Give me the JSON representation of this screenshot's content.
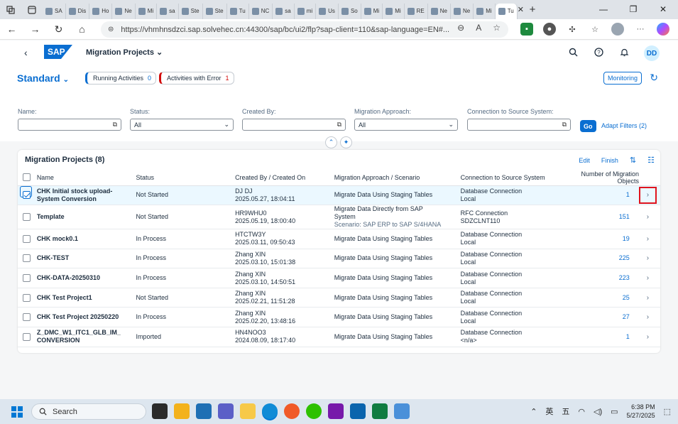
{
  "browser": {
    "tabs": [
      "SA",
      "Dis",
      "Ho",
      "Ne",
      "Mi",
      "sa",
      "Ste",
      "Ste",
      "Tu",
      "NC",
      "sa",
      "mi",
      "Us",
      "So",
      "Mi",
      "Mi",
      "RE",
      "Ne",
      "Ne",
      "Mi",
      "Tu"
    ],
    "url": "https://vhmhnsdzci.sap.solvehec.cn:44300/sap/bc/ui2/flp?sap-client=110&sap-language=EN#..."
  },
  "shell": {
    "logo": "SAP",
    "title": "Migration Projects",
    "avatar": "DD"
  },
  "header": {
    "variant": "Standard",
    "running_label": "Running Activities",
    "running_count": "0",
    "error_label": "Activities with Error",
    "error_count": "1",
    "monitoring": "Monitoring"
  },
  "filters": {
    "name_label": "Name:",
    "name_value": "",
    "status_label": "Status:",
    "status_value": "All",
    "created_by_label": "Created By:",
    "created_by_value": "",
    "approach_label": "Migration Approach:",
    "approach_value": "All",
    "connection_label": "Connection to Source System:",
    "connection_value": "",
    "go": "Go",
    "adapt": "Adapt Filters (2)"
  },
  "table": {
    "title": "Migration Projects (8)",
    "edit": "Edit",
    "finish": "Finish",
    "columns": [
      "Name",
      "Status",
      "Created By / Created On",
      "Migration Approach / Scenario",
      "Connection to Source System",
      "Number of Migration Objects"
    ],
    "rows": [
      {
        "name1": "CHK Initial stock upload-",
        "name2": "System Conversion",
        "status": "Not Started",
        "by": "DJ DJ",
        "on": "2025.05.27, 18:04:11",
        "approach1": "Migrate Data Using Staging Tables",
        "approach2": "",
        "approach3": "",
        "conn1": "Database Connection",
        "conn2": "Local",
        "count": "1"
      },
      {
        "name1": "Template",
        "name2": "",
        "status": "Not Started",
        "by": "HR9WHU0",
        "on": "2025.05.19, 18:00:40",
        "approach1": "Migrate Data Directly from SAP",
        "approach2": "System",
        "approach3": "Scenario: SAP ERP to SAP S/4HANA",
        "conn1": "RFC Connection",
        "conn2": "SDZCLNT110",
        "count": "151"
      },
      {
        "name1": "CHK mock0.1",
        "name2": "",
        "status": "In Process",
        "by": "HTCTW3Y",
        "on": "2025.03.11, 09:50:43",
        "approach1": "Migrate Data Using Staging Tables",
        "approach2": "",
        "approach3": "",
        "conn1": "Database Connection",
        "conn2": "Local",
        "count": "19"
      },
      {
        "name1": "CHK-TEST",
        "name2": "",
        "status": "In Process",
        "by": "Zhang XIN",
        "on": "2025.03.10, 15:01:38",
        "approach1": "Migrate Data Using Staging Tables",
        "approach2": "",
        "approach3": "",
        "conn1": "Database Connection",
        "conn2": "Local",
        "count": "225"
      },
      {
        "name1": "CHK-DATA-20250310",
        "name2": "",
        "status": "In Process",
        "by": "Zhang XIN",
        "on": "2025.03.10, 14:50:51",
        "approach1": "Migrate Data Using Staging Tables",
        "approach2": "",
        "approach3": "",
        "conn1": "Database Connection",
        "conn2": "Local",
        "count": "223"
      },
      {
        "name1": "CHK Test Project1",
        "name2": "",
        "status": "Not Started",
        "by": "Zhang XIN",
        "on": "2025.02.21, 11:51:28",
        "approach1": "Migrate Data Using Staging Tables",
        "approach2": "",
        "approach3": "",
        "conn1": "Database Connection",
        "conn2": "Local",
        "count": "25"
      },
      {
        "name1": "CHK Test Project 20250220",
        "name2": "",
        "status": "In Process",
        "by": "Zhang XIN",
        "on": "2025.02.20, 13:48:16",
        "approach1": "Migrate Data Using Staging Tables",
        "approach2": "",
        "approach3": "",
        "conn1": "Database Connection",
        "conn2": "Local",
        "count": "27"
      },
      {
        "name1": "Z_DMC_W1_ITC1_GLB_IM_",
        "name2": "CONVERSION",
        "status": "Imported",
        "by": "HN4NOO3",
        "on": "2024.08.09, 18:17:40",
        "approach1": "Migrate Data Using Staging Tables",
        "approach2": "",
        "approach3": "",
        "conn1": "Database Connection",
        "conn2": "<n/a>",
        "count": "1"
      }
    ]
  },
  "taskbar": {
    "search": "Search",
    "lang1": "英",
    "lang2": "五",
    "time": "6:38 PM",
    "date": "5/27/2025"
  },
  "colors": {
    "accent": "#0a6ed1",
    "error": "#d20a0a",
    "highlight_box": "#e0141e"
  }
}
